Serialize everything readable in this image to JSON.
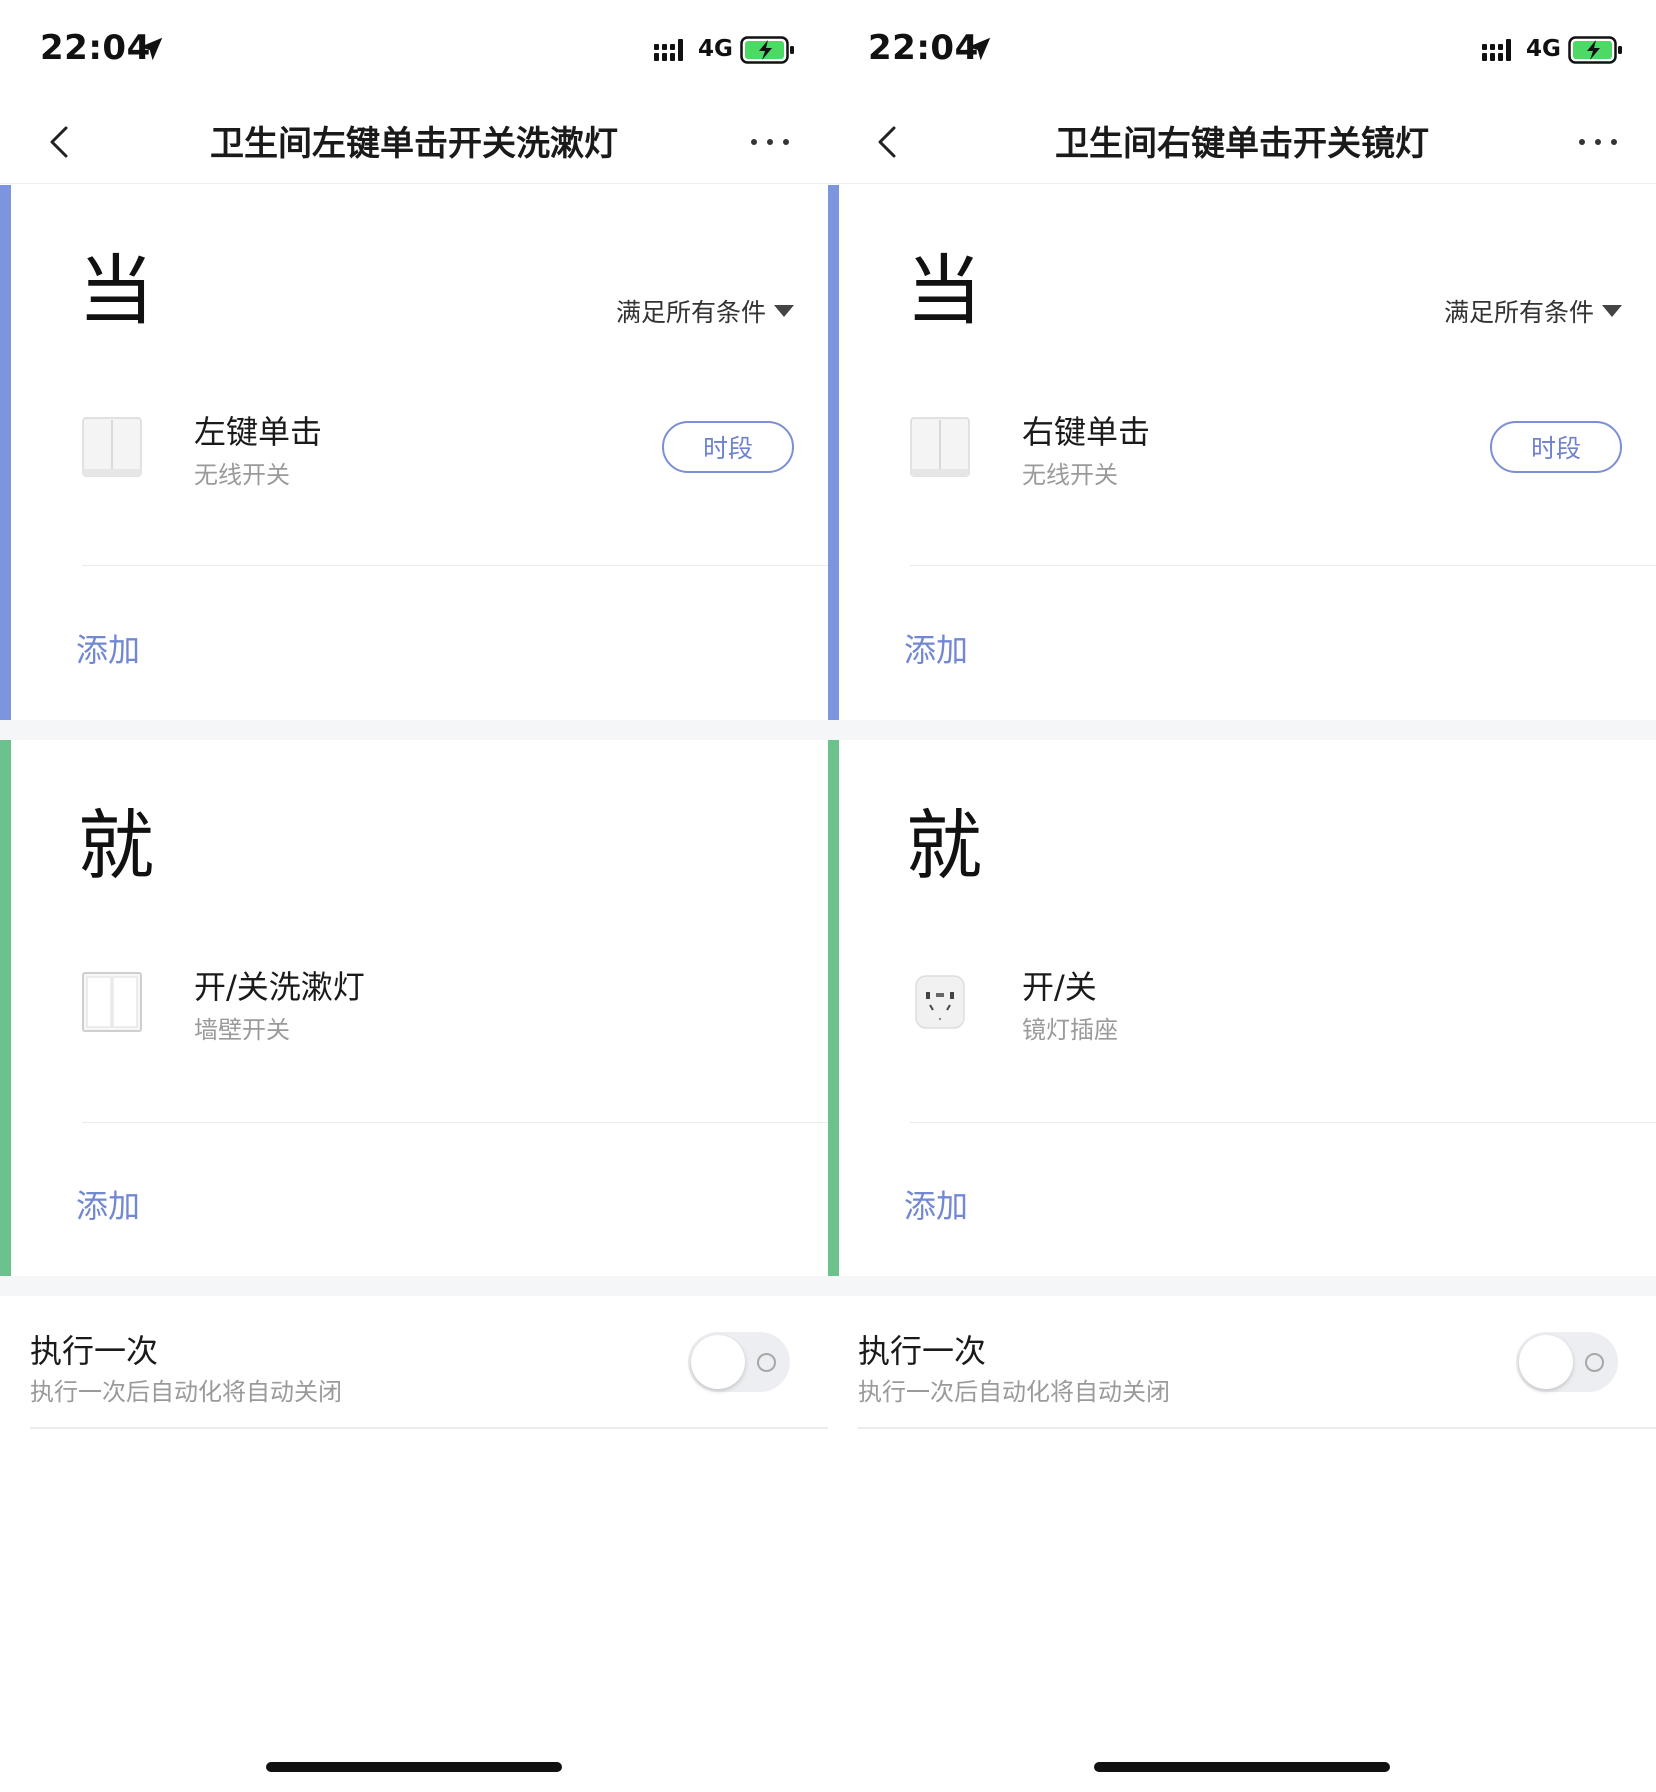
{
  "colors": {
    "condition_accent": "#7d95de",
    "action_accent": "#6cc28c",
    "link": "#7388d3",
    "section_gap": "#f5f6f8"
  },
  "screens": [
    {
      "status": {
        "time": "22:04",
        "network": "4G"
      },
      "nav": {
        "title": "卫生间左键单击开关洗漱灯"
      },
      "when": {
        "heading": "当",
        "mode": "满足所有条件",
        "condition": {
          "title": "左键单击",
          "subtitle": "无线开关",
          "icon": "wireless-switch-icon",
          "button": "时段"
        },
        "add": "添加"
      },
      "then": {
        "heading": "就",
        "action": {
          "title": "开/关洗漱灯",
          "subtitle": "墙壁开关",
          "icon": "wall-switch-icon"
        },
        "add": "添加"
      },
      "run_once": {
        "title": "执行一次",
        "subtitle": "执行一次后自动化将自动关闭",
        "enabled": false
      }
    },
    {
      "status": {
        "time": "22:04",
        "network": "4G"
      },
      "nav": {
        "title": "卫生间右键单击开关镜灯"
      },
      "when": {
        "heading": "当",
        "mode": "满足所有条件",
        "condition": {
          "title": "右键单击",
          "subtitle": "无线开关",
          "icon": "wireless-switch-icon",
          "button": "时段"
        },
        "add": "添加"
      },
      "then": {
        "heading": "就",
        "action": {
          "title": "开/关",
          "subtitle": "镜灯插座",
          "icon": "smart-plug-icon"
        },
        "add": "添加"
      },
      "run_once": {
        "title": "执行一次",
        "subtitle": "执行一次后自动化将自动关闭",
        "enabled": false
      }
    }
  ]
}
